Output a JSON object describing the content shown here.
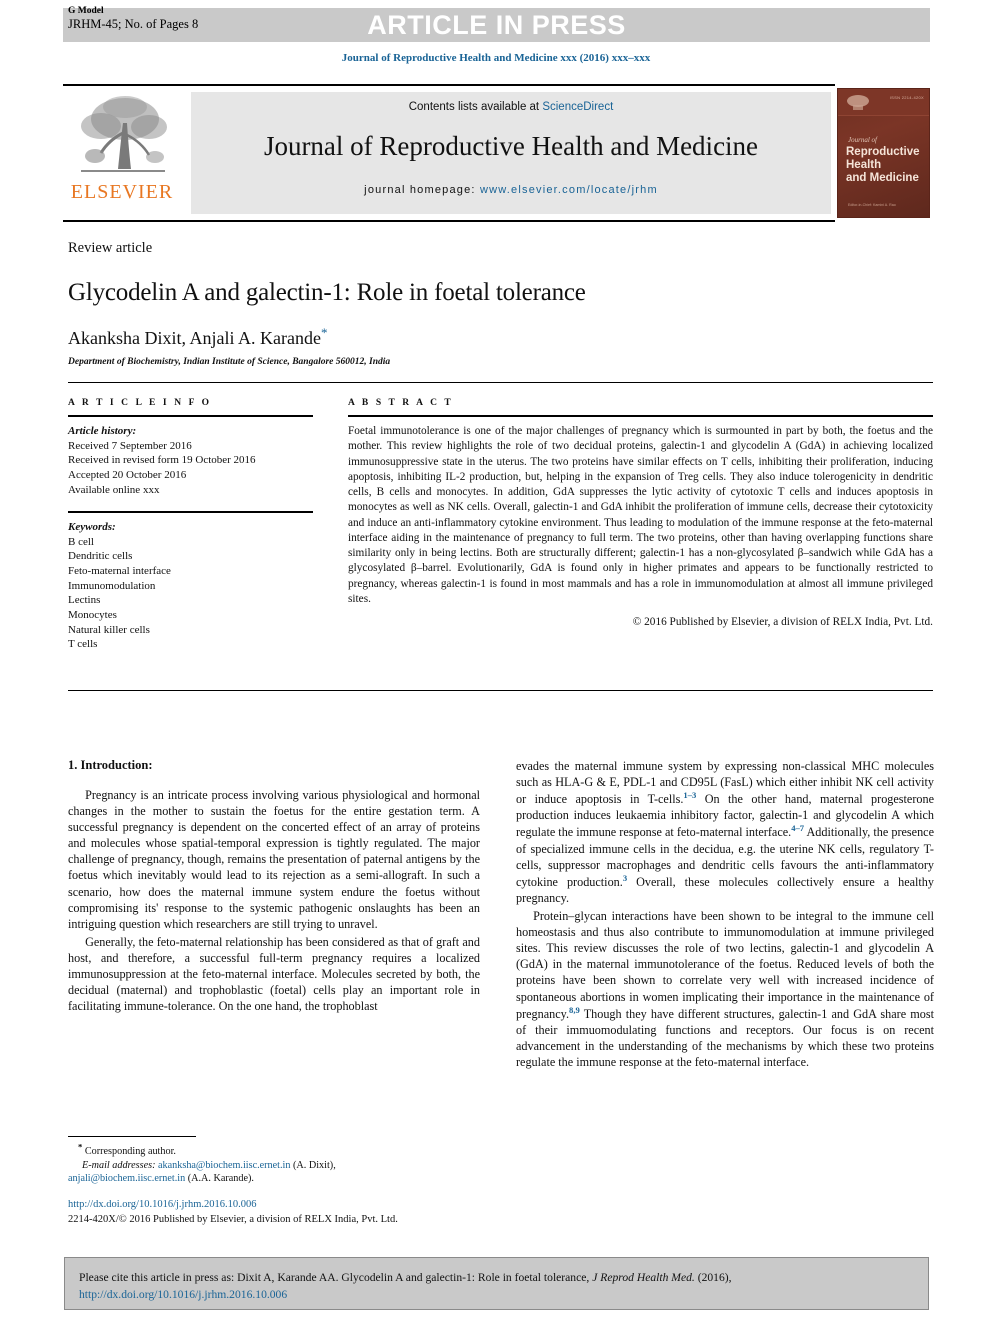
{
  "header": {
    "g_model": "G Model",
    "manuscript_id": "JRHM-45; No. of Pages 8",
    "banner": "ARTICLE IN PRESS",
    "journal_ref": "Journal of Reproductive Health and Medicine xxx (2016) xxx–xxx"
  },
  "masthead": {
    "contents_prefix": "Contents lists available at ",
    "sciencedirect": "ScienceDirect",
    "journal_title": "Journal of Reproductive Health and Medicine",
    "homepage_label": "journal homepage: ",
    "homepage_url": "www.elsevier.com/locate/jrhm",
    "publisher": "ELSEVIER",
    "cover": {
      "journal_of": "Journal of",
      "title_line1": "Reproductive Health",
      "title_line2": "and Medicine",
      "issn": "ISSN 2214-420X",
      "footer": "Editor-in-Chief: Kamini A. Rao"
    }
  },
  "article": {
    "type": "Review article",
    "title": "Glycodelin A and galectin-1: Role in foetal tolerance",
    "authors": "Akanksha Dixit, Anjali A. Karande",
    "corresponding_marker": "*",
    "affiliation": "Department of Biochemistry, Indian Institute of Science, Bangalore 560012, India"
  },
  "article_info": {
    "label": "A R T I C L E   I N F O",
    "history_label": "Article history:",
    "history": [
      "Received 7 September 2016",
      "Received in revised form 19 October 2016",
      "Accepted 20 October 2016",
      "Available online xxx"
    ],
    "keywords_label": "Keywords:",
    "keywords": [
      "B cell",
      "Dendritic cells",
      "Feto-maternal interface",
      "Immunomodulation",
      "Lectins",
      "Monocytes",
      "Natural killer cells",
      "T cells"
    ]
  },
  "abstract": {
    "label": "A B S T R A C T",
    "text": "Foetal immunotolerance is one of the major challenges of pregnancy which is surmounted in part by both, the foetus and the mother. This review highlights the role of two decidual proteins, galectin-1 and glycodelin A (GdA) in achieving localized immunosuppressive state in the uterus. The two proteins have similar effects on T cells, inhibiting their proliferation, inducing apoptosis, inhibiting IL-2 production, but, helping in the expansion of Treg cells. They also induce tolerogenicity in dendritic cells, B cells and monocytes. In addition, GdA suppresses the lytic activity of cytotoxic T cells and induces apoptosis in monocytes as well as NK cells. Overall, galectin-1 and GdA inhibit the proliferation of immune cells, decrease their cytotoxicity and induce an anti-inflammatory cytokine environment. Thus leading to modulation of the immune response at the feto-maternal interface aiding in the maintenance of pregnancy to full term. The two proteins, other than having overlapping functions share similarity only in being lectins. Both are structurally different; galectin-1 has a non-glycosylated β–sandwich while GdA has a glycosylated β–barrel. Evolutionarily, GdA is found only in higher primates and appears to be functionally restricted to pregnancy, whereas galectin-1 is found in most mammals and has a role in immunomodulation at almost all immune privileged sites.",
    "copyright": "© 2016 Published by Elsevier, a division of RELX India, Pvt. Ltd."
  },
  "body": {
    "section_heading": "1. Introduction:",
    "left_paragraphs": [
      "Pregnancy is an intricate process involving various physiological and hormonal changes in the mother to sustain the foetus for the entire gestation term. A successful pregnancy is dependent on the concerted effect of an array of proteins and molecules whose spatial-temporal expression is tightly regulated. The major challenge of pregnancy, though, remains the presentation of paternal antigens by the foetus which inevitably would lead to its rejection as a semi-allograft. In such a scenario, how does the maternal immune system endure the foetus without compromising its' response to the systemic pathogenic onslaughts has been an intriguing question which researchers are still trying to unravel.",
      "Generally, the feto-maternal relationship has been considered as that of graft and host, and therefore, a successful full-term pregnancy requires a localized immunosuppression at the feto-maternal interface. Molecules secreted by both, the decidual (maternal) and trophoblastic (foetal) cells play an important role in facilitating immune-tolerance. On the one hand, the trophoblast"
    ],
    "right_paragraph_1_parts": {
      "a": "evades the maternal immune system by expressing non-classical MHC molecules such as HLA-G & E, PDL-1 and CD95L (FasL) which either inhibit NK cell activity or induce apoptosis in T-cells.",
      "ref1": "1–3",
      "b": " On the other hand, maternal progesterone production induces leukaemia inhibitory factor, galectin-1 and glycodelin A which regulate the immune response at feto-maternal interface.",
      "ref2": "4–7",
      "c": " Additionally, the presence of specialized immune cells in the decidua, e.g. the uterine NK cells, regulatory T-cells, suppressor macrophages and dendritic cells favours the anti-inflammatory cytokine production.",
      "ref3": "3",
      "d": " Overall, these molecules collectively ensure a healthy pregnancy."
    },
    "right_paragraph_2_parts": {
      "a": "Protein–glycan interactions have been shown to be integral to the immune cell homeostasis and thus also contribute to immunomodulation at immune privileged sites. This review discusses the role of two lectins, galectin-1 and glycodelin A (GdA) in the maternal immunotolerance of the foetus. Reduced levels of both the proteins have been shown to correlate very well with increased incidence of spontaneous abortions in women implicating their importance in the maintenance of pregnancy.",
      "ref1": "8,9",
      "b": " Though they have different structures, galectin-1 and GdA share most of their immuomodulating functions and receptors. Our focus is on recent advancement in the understanding of the mechanisms by which these two proteins regulate the immune response at the feto-maternal interface."
    }
  },
  "footnote": {
    "marker": "*",
    "corresponding": "Corresponding author.",
    "email_label": "E-mail addresses:",
    "email1": "akanksha@biochem.iisc.ernet.in",
    "email1_owner": " (A. Dixit),",
    "email2": "anjali@biochem.iisc.ernet.in",
    "email2_owner": " (A.A. Karande)."
  },
  "doi_block": {
    "doi_url": "http://dx.doi.org/10.1016/j.jrhm.2016.10.006",
    "issn_line": "2214-420X/© 2016 Published by Elsevier, a division of RELX India, Pvt. Ltd."
  },
  "citation_box": {
    "prefix": "Please cite this article in press as: Dixit  A, Karande  AA. Glycodelin A and galectin-1: Role in foetal tolerance, ",
    "journal_abbrev": "J Reprod Health Med.",
    "year": " (2016),",
    "url": "http://dx.doi.org/10.1016/j.jrhm.2016.10.006"
  },
  "colors": {
    "link_blue": "#1a6496",
    "elsevier_orange": "#E87722",
    "banner_gray": "#c9c9c9",
    "masthead_gray": "#e6e6e6"
  }
}
